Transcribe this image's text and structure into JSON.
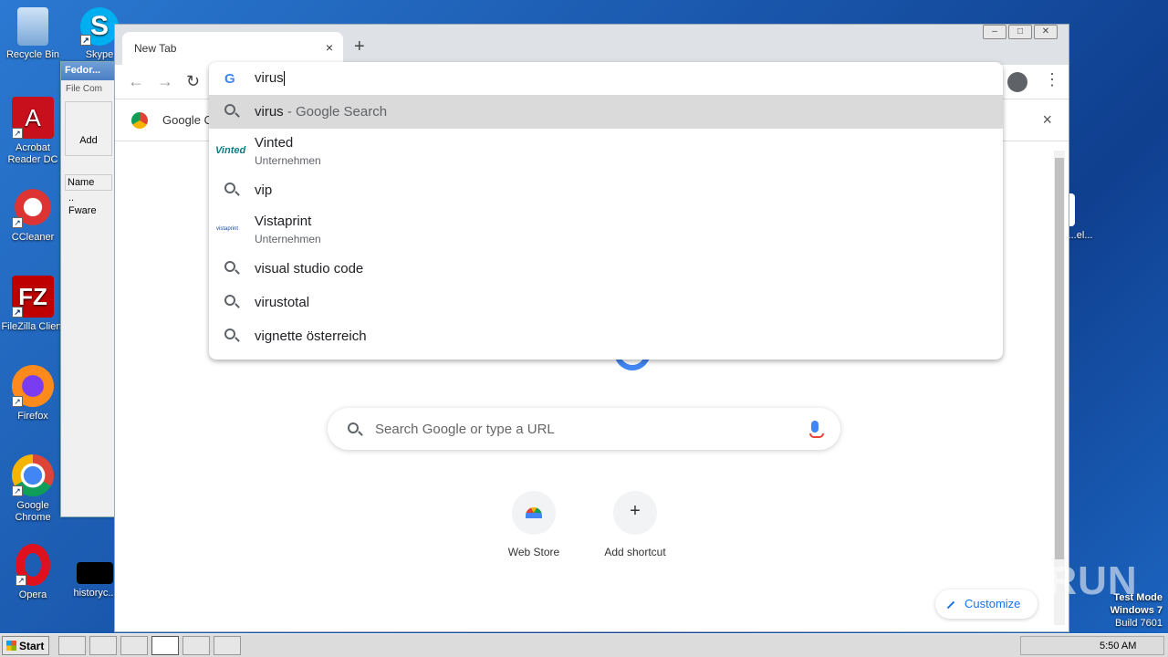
{
  "desktop": {
    "icons": [
      {
        "label": "Recycle Bin"
      },
      {
        "label": "Skype"
      },
      {
        "label": "Acrobat Reader DC"
      },
      {
        "label": "CCleaner"
      },
      {
        "label": "FileZilla Client"
      },
      {
        "label": "Firefox"
      },
      {
        "label": "Google Chrome"
      },
      {
        "label": "Opera"
      },
      {
        "label": "historyc..."
      },
      {
        "label": "...el..."
      }
    ],
    "watermark": "ANY RUN",
    "test_mode": {
      "line1": "Test Mode",
      "line2": "Windows 7",
      "line3": "Build 7601"
    }
  },
  "bg_window": {
    "title": "Fedor...",
    "menu": "File  Com",
    "add": "Add",
    "col_name": "Name",
    "row1": "..",
    "row2": "Fware"
  },
  "chrome": {
    "tab_title": "New Tab",
    "tab_close": "×",
    "new_tab": "+",
    "infobar_text": "Google Chrome",
    "infobar_close": "×",
    "omnibox": {
      "value": "virus",
      "suggestions": [
        {
          "typed": "virus",
          "rest": " - Google Search",
          "type": "search",
          "selected": true
        },
        {
          "typed": "Vi",
          "rest": "nted",
          "sub": "Unternehmen",
          "type": "entity",
          "logo": "Vinted"
        },
        {
          "typed": "vi",
          "rest": "p",
          "type": "search"
        },
        {
          "typed": "Vi",
          "rest": "staprint",
          "sub": "Unternehmen",
          "type": "entity",
          "logo": "vistaprint"
        },
        {
          "typed": "vi",
          "rest": "sual studio code",
          "type": "search"
        },
        {
          "typed": "virus",
          "rest": "total",
          "type": "search"
        },
        {
          "typed": "vi",
          "rest": "gnette österreich",
          "type": "search"
        }
      ]
    },
    "ntp": {
      "search_placeholder": "Search Google or type a URL",
      "shortcuts": [
        {
          "label": "Web Store"
        },
        {
          "label": "Add shortcut",
          "glyph": "+"
        }
      ],
      "customize": "Customize"
    }
  },
  "taskbar": {
    "start": "Start",
    "clock": "5:50 AM"
  }
}
